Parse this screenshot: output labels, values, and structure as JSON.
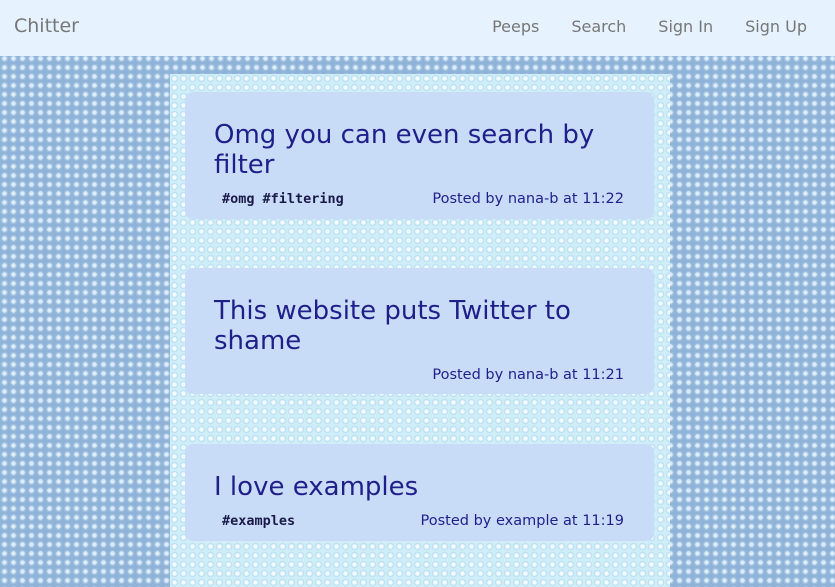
{
  "navbar": {
    "brand": "Chitter",
    "links": [
      "Peeps",
      "Search",
      "Sign In",
      "Sign Up"
    ]
  },
  "peeps": [
    {
      "text": "Omg you can even search by filter",
      "tags": [
        "#omg",
        "#filtering"
      ],
      "posted_prefix": "Posted by",
      "author": "nana-b",
      "at": "at",
      "time": "11:22"
    },
    {
      "text": "This website puts Twitter to shame",
      "tags": [],
      "posted_prefix": "Posted by",
      "author": "nana-b",
      "at": "at",
      "time": "11:21"
    },
    {
      "text": "I love examples",
      "tags": [
        "#examples"
      ],
      "posted_prefix": "Posted by",
      "author": "example",
      "at": "at",
      "time": "11:19"
    }
  ],
  "colors": {
    "navbar_bg": "#e6f2fd",
    "peep_bg": "#c9dcf7",
    "peep_text": "#1f1f8a"
  }
}
